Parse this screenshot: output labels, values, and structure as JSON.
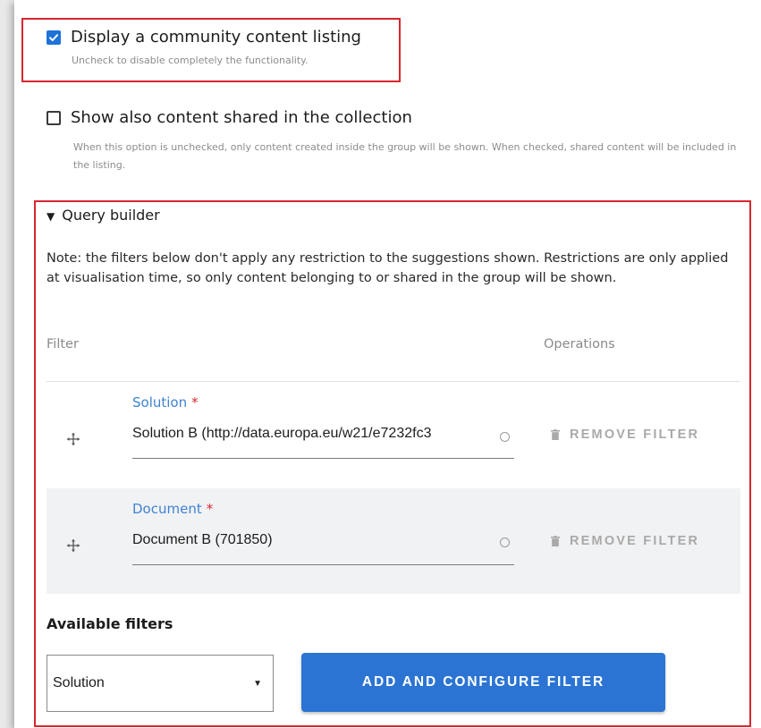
{
  "community_listing": {
    "checked": true,
    "label": "Display a community content listing",
    "help": "Uncheck to disable completely the functionality."
  },
  "shared_content": {
    "checked": false,
    "label": "Show also content shared in the collection",
    "help": "When this option is unchecked, only content created inside the group will be shown. When checked, shared content will be included in the listing."
  },
  "query_builder": {
    "summary": "Query builder",
    "expanded": true,
    "note": "Note: the filters below don't apply any restriction to the suggestions shown. Restrictions are only applied at visualisation time, so only content belonging to or shared in the group will be shown.",
    "table": {
      "headers": {
        "filter": "Filter",
        "operations": "Operations"
      },
      "rows": [
        {
          "label": "Solution",
          "required_mark": "*",
          "value": "Solution B (http://data.europa.eu/w21/e7232fc3",
          "remove_label": "REMOVE FILTER"
        },
        {
          "label": "Document",
          "required_mark": "*",
          "value": "Document B (701850)",
          "remove_label": "REMOVE FILTER"
        }
      ]
    },
    "available_filters": {
      "label": "Available filters",
      "selected": "Solution",
      "add_button": "ADD AND CONFIGURE FILTER"
    }
  },
  "colors": {
    "accent": "#2b74d3",
    "checkbox_checked": "#1f72d8",
    "highlight_border": "#d8262e",
    "field_label": "#3f83d3",
    "required": "#d8262e",
    "muted_text": "#8c8c8c",
    "alt_row": "#f1f2f4"
  },
  "icons": {
    "drag_handle": "move-arrows-icon",
    "remove": "trash-icon",
    "autocomplete": "circle-spinner-icon",
    "select_arrow": "caret-down-icon",
    "summary": "triangle-down-icon",
    "check": "checkmark-icon"
  }
}
